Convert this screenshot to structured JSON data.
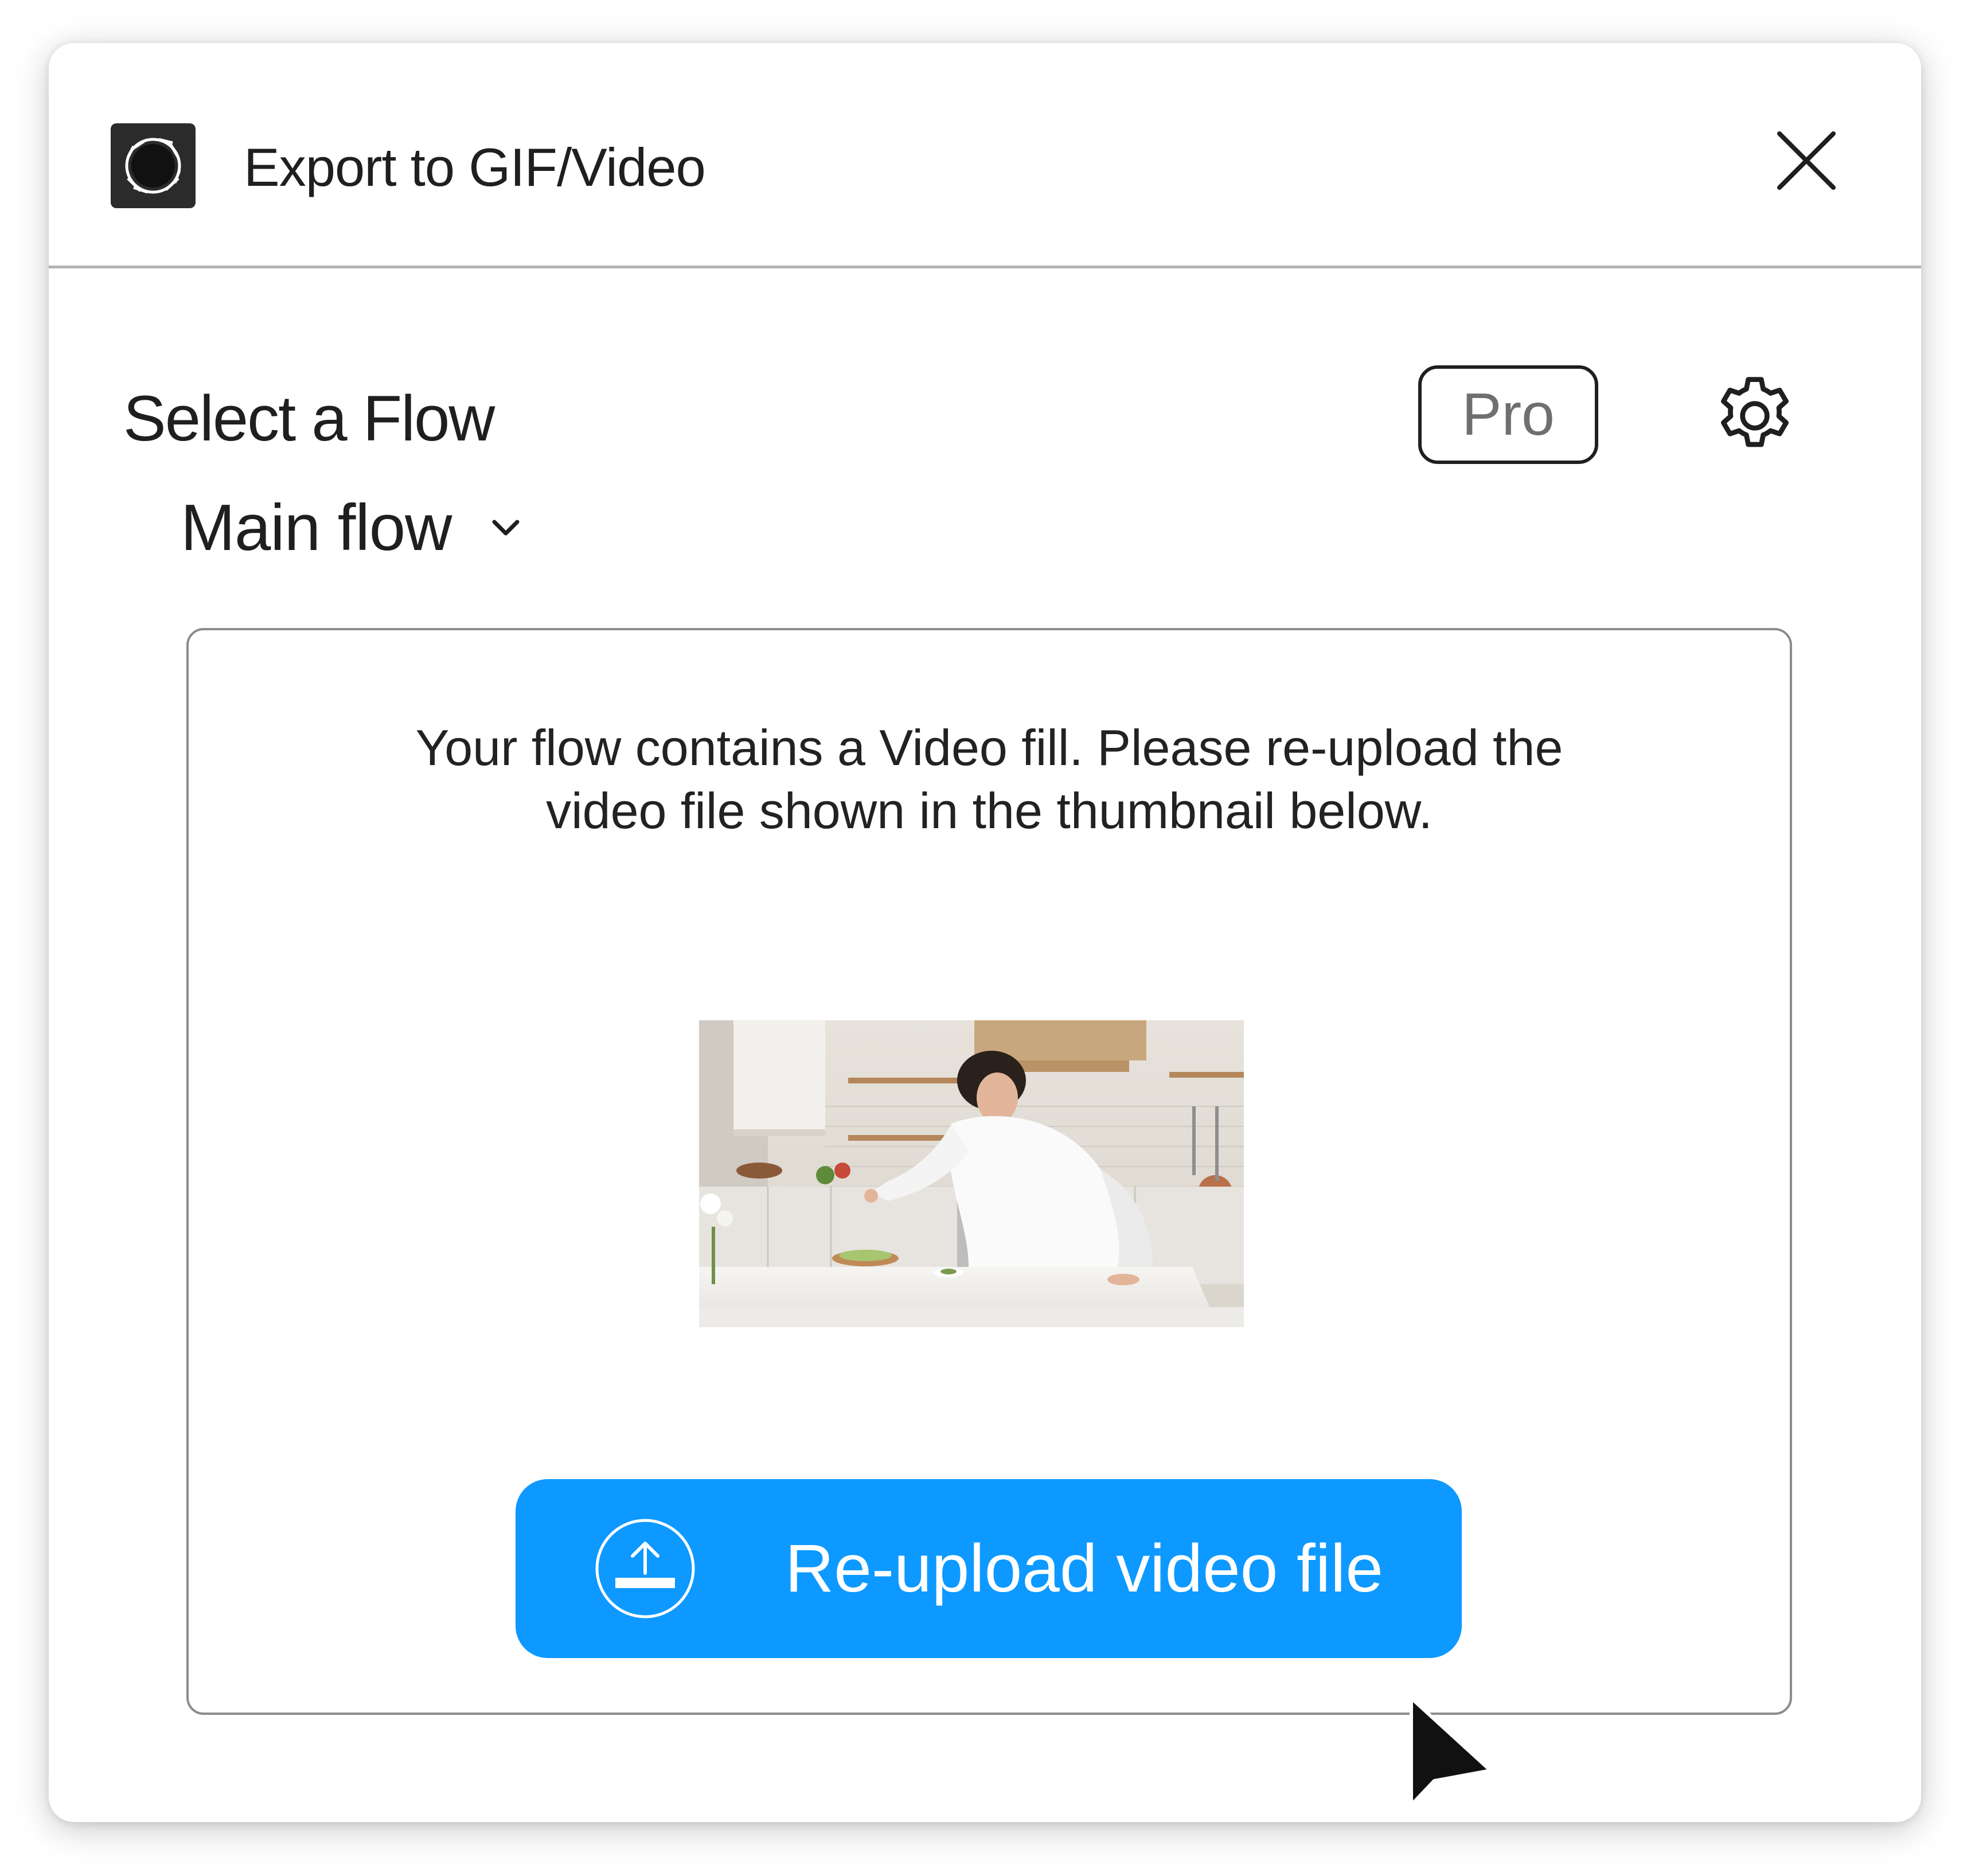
{
  "dialog": {
    "title": "Export to GIF/Video",
    "app_icon": "camera-aperture-logo-icon",
    "close_icon": "close-icon"
  },
  "flow_section": {
    "title": "Select a Flow",
    "pro_label": "Pro",
    "settings_icon": "gear-icon",
    "selected_flow": "Main flow",
    "dropdown_icon": "chevron-down-icon"
  },
  "content": {
    "message_line1": "Your flow contains a Video fill. Please re-upload the",
    "message_line2": "video file shown in the thumbnail below.",
    "thumbnail_icon": "video-thumbnail",
    "upload_button_label": "Re-upload video file",
    "upload_icon": "upload-icon"
  },
  "colors": {
    "accent": "#0d99ff",
    "text": "#1f1f1f",
    "muted": "#6f6f6f",
    "border": "#8c8c8c"
  }
}
